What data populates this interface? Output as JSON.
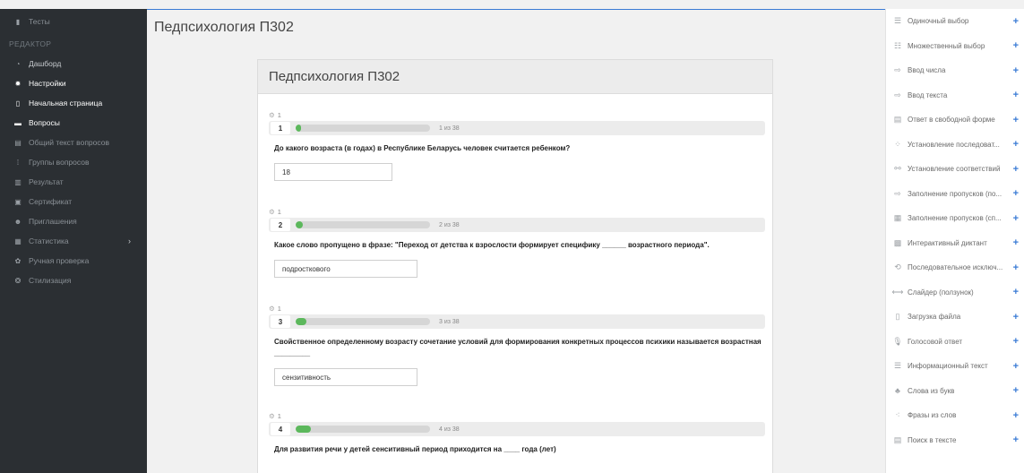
{
  "sidebar": {
    "tests_label": "Тесты",
    "editor_section": "РЕДАКТОР",
    "items": [
      {
        "label": "Дашборд",
        "icon": "dashboard-icon"
      },
      {
        "label": "Настройки",
        "icon": "gear-icon"
      },
      {
        "label": "Начальная страница",
        "icon": "page-icon"
      },
      {
        "label": "Вопросы",
        "icon": "questions-icon"
      },
      {
        "label": "Общий текст вопросов",
        "icon": "document-icon"
      },
      {
        "label": "Группы вопросов",
        "icon": "groups-icon"
      },
      {
        "label": "Результат",
        "icon": "bar-chart-icon"
      },
      {
        "label": "Сертификат",
        "icon": "certificate-icon"
      },
      {
        "label": "Приглашения",
        "icon": "invite-icon"
      },
      {
        "label": "Статистика",
        "icon": "statistics-icon"
      },
      {
        "label": "Ручная проверка",
        "icon": "manual-check-icon"
      },
      {
        "label": "Стилизация",
        "icon": "style-icon"
      }
    ]
  },
  "page_title": "Педпсихология П302",
  "card": {
    "title": "Педпсихология П302",
    "questions": [
      {
        "points": "1",
        "number": "1",
        "of": "1 из 38",
        "progress": 0.03,
        "text": "До какого возраста (в годах) в Республике Беларусь человек считается ребенком?",
        "answer": "18"
      },
      {
        "points": "1",
        "number": "2",
        "of": "2 из 38",
        "progress": 0.05,
        "text": "Какое слово пропущено в фразе: \"Переход от детства к взрослости формирует специфику ______ возрастного периода\".",
        "answer": "подросткового"
      },
      {
        "points": "1",
        "number": "3",
        "of": "3 из 38",
        "progress": 0.08,
        "text": "Свойственное определенному возрасту сочетание условий для формирования конкретных процессов психики называется возрастная _________",
        "answer": "сензитивность"
      },
      {
        "points": "1",
        "number": "4",
        "of": "4 из 38",
        "progress": 0.11,
        "text": "Для развития речи у детей сенситивный период приходится на ____ года (лет)",
        "answer": ""
      }
    ]
  },
  "right_panel": {
    "items": [
      {
        "label": "Одиночный выбор",
        "icon": "single-choice-icon"
      },
      {
        "label": "Множественный выбор",
        "icon": "multiple-choice-icon"
      },
      {
        "label": "Ввод числа",
        "icon": "number-input-icon"
      },
      {
        "label": "Ввод текста",
        "icon": "text-input-icon"
      },
      {
        "label": "Ответ в свободной форме",
        "icon": "free-form-icon"
      },
      {
        "label": "Установление последоват...",
        "icon": "sequence-icon"
      },
      {
        "label": "Установление соответствий",
        "icon": "match-icon"
      },
      {
        "label": "Заполнение пропусков (по...",
        "icon": "fill-gaps-icon"
      },
      {
        "label": "Заполнение пропусков (сп...",
        "icon": "fill-gaps-list-icon"
      },
      {
        "label": "Интерактивный диктант",
        "icon": "dictation-icon"
      },
      {
        "label": "Последовательное исключ...",
        "icon": "exclusion-icon"
      },
      {
        "label": "Слайдер (ползунок)",
        "icon": "slider-icon"
      },
      {
        "label": "Загрузка файла",
        "icon": "file-upload-icon"
      },
      {
        "label": "Голосовой ответ",
        "icon": "microphone-icon"
      },
      {
        "label": "Информационный текст",
        "icon": "info-text-icon"
      },
      {
        "label": "Слова из букв",
        "icon": "letters-icon"
      },
      {
        "label": "Фразы из слов",
        "icon": "phrases-icon"
      },
      {
        "label": "Поиск в тексте",
        "icon": "text-search-icon"
      }
    ]
  },
  "colors": {
    "accent": "#3a7bd5",
    "progress": "#5cb85c",
    "sidebar_bg": "#2b2f33"
  }
}
